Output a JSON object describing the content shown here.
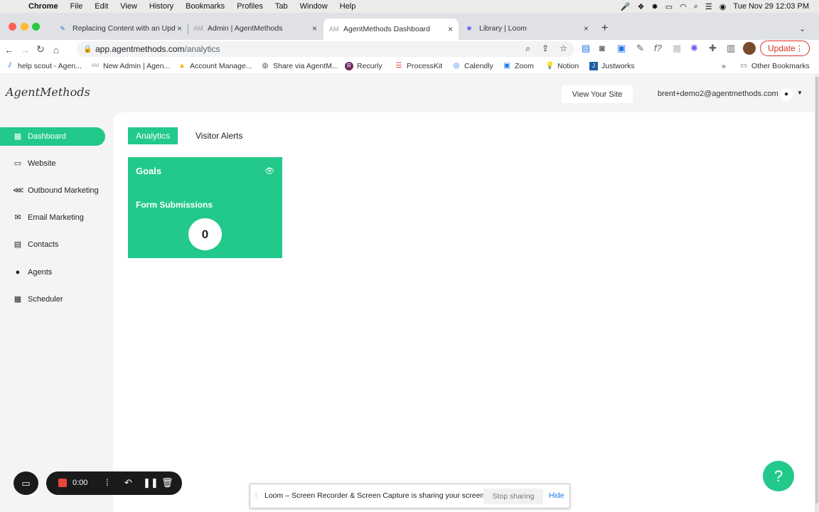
{
  "menubar": {
    "app": "Chrome",
    "items": [
      "File",
      "Edit",
      "View",
      "History",
      "Bookmarks",
      "Profiles",
      "Tab",
      "Window",
      "Help"
    ],
    "clock": "Tue Nov 29  12:03 PM"
  },
  "tabs": [
    {
      "title": "Replacing Content with an Upd",
      "icon": "feather-icon"
    },
    {
      "title": "Admin | AgentMethods",
      "icon": "am-icon"
    },
    {
      "title": "AgentMethods Dashboard",
      "icon": "am-icon",
      "active": true
    },
    {
      "title": "Library | Loom",
      "icon": "loom-icon"
    }
  ],
  "address": {
    "domain": "app.agentmethods.com",
    "path": "/analytics"
  },
  "update_label": "Update",
  "bookmarks": [
    {
      "label": "help scout - Agen..."
    },
    {
      "label": "New Admin | Agen..."
    },
    {
      "label": "Account Manage..."
    },
    {
      "label": "Share via AgentM..."
    },
    {
      "label": "Recurly"
    },
    {
      "label": "ProcessKit"
    },
    {
      "label": "Calendly"
    },
    {
      "label": "Zoom"
    },
    {
      "label": "Notion"
    },
    {
      "label": "Justworks"
    }
  ],
  "other_bookmarks": "Other Bookmarks",
  "header": {
    "logo": "AgentMethods",
    "view_site": "View Your Site",
    "email": "brent+demo2@agentmethods.com"
  },
  "sidebar": {
    "items": [
      {
        "label": "Dashboard",
        "icon": "dashboard-icon",
        "active": true
      },
      {
        "label": "Website",
        "icon": "website-icon"
      },
      {
        "label": "Outbound Marketing",
        "icon": "share-icon"
      },
      {
        "label": "Email Marketing",
        "icon": "mail-icon"
      },
      {
        "label": "Contacts",
        "icon": "contacts-icon"
      },
      {
        "label": "Agents",
        "icon": "person-icon"
      },
      {
        "label": "Scheduler",
        "icon": "calendar-icon"
      }
    ]
  },
  "main": {
    "tabs": [
      {
        "label": "Analytics",
        "active": true
      },
      {
        "label": "Visitor Alerts"
      }
    ],
    "card": {
      "title": "Goals",
      "subtitle": "Form Submissions",
      "value": "0"
    }
  },
  "help_label": "?",
  "loom": {
    "timer": "0:00",
    "share_message": "Loom – Screen Recorder & Screen Capture is sharing your screen.",
    "stop_label": "Stop sharing",
    "hide_label": "Hide"
  },
  "colors": {
    "accent": "#22c98a",
    "update": "#d93025"
  }
}
